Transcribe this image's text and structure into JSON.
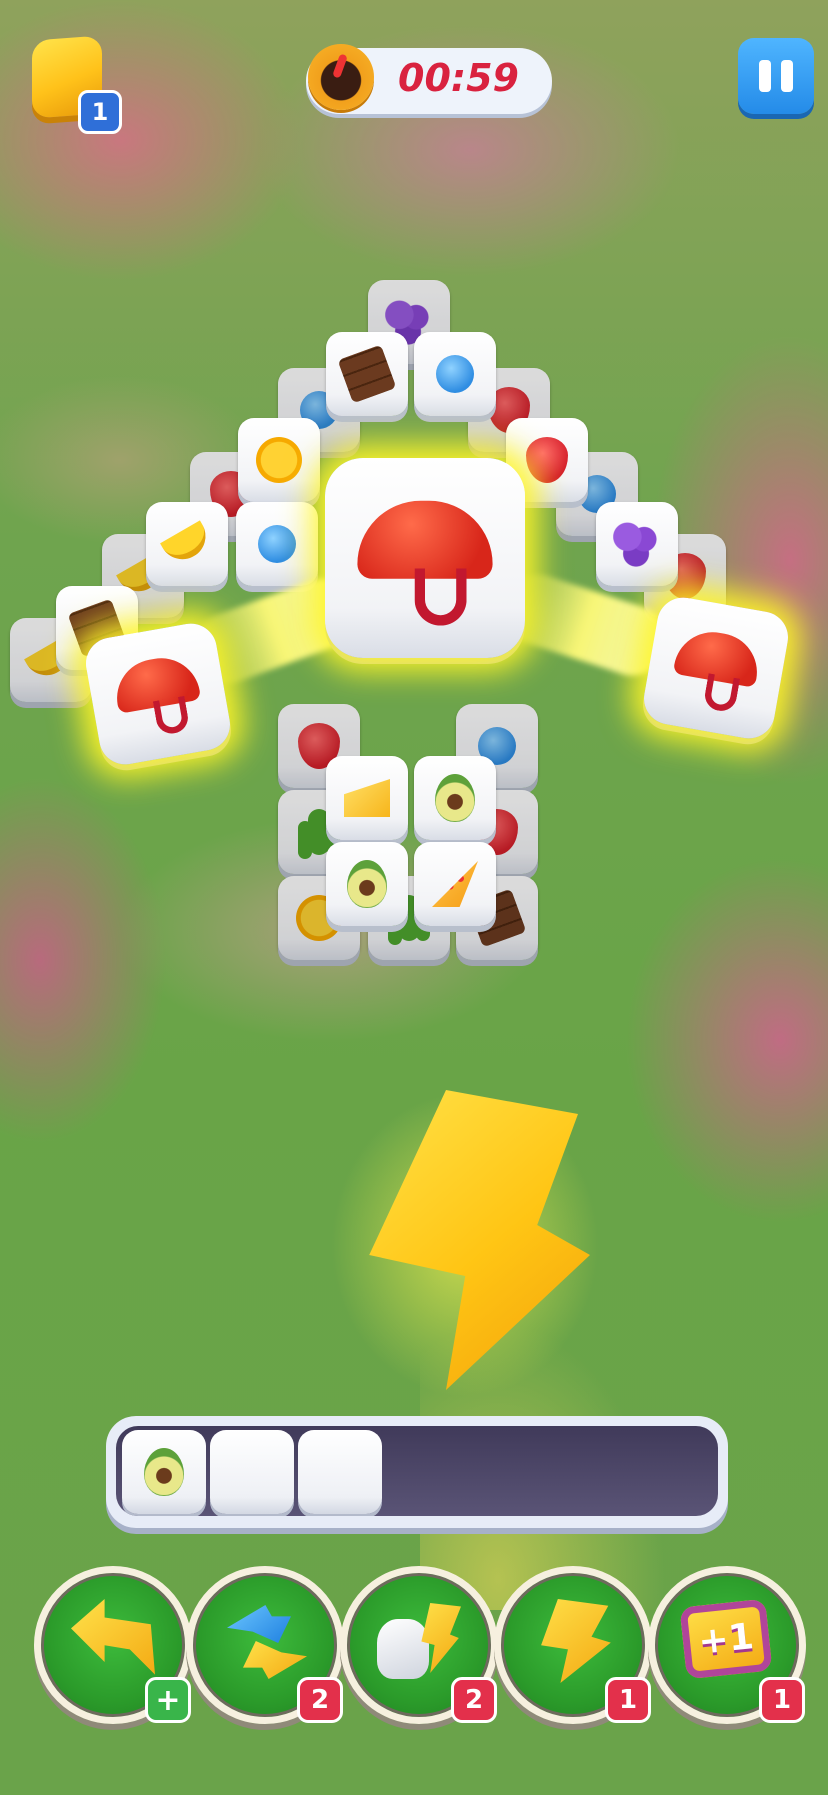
{
  "hud": {
    "lives_count": "1",
    "timer": "00:59",
    "pause_icon": "pause-icon"
  },
  "board": {
    "tiles": [
      {
        "symbol": "grape"
      },
      {
        "symbol": "chocolate"
      },
      {
        "symbol": "candy"
      },
      {
        "symbol": "sun"
      },
      {
        "symbol": "strawberry"
      },
      {
        "symbol": "banana"
      },
      {
        "symbol": "candy"
      },
      {
        "symbol": "grape"
      },
      {
        "symbol": "banana"
      },
      {
        "symbol": "chocolate"
      },
      {
        "symbol": "strawberry"
      },
      {
        "symbol": "cactus"
      },
      {
        "symbol": "grape"
      },
      {
        "symbol": "cheese"
      },
      {
        "symbol": "avocado"
      },
      {
        "symbol": "avocado"
      },
      {
        "symbol": "pizza"
      },
      {
        "symbol": "candy"
      }
    ],
    "matched_tiles": [
      {
        "symbol": "umbrella"
      },
      {
        "symbol": "umbrella"
      },
      {
        "symbol": "umbrella"
      }
    ]
  },
  "effect": {
    "icon": "lightning-bolt-icon"
  },
  "tray": {
    "capacity": 7,
    "slots": [
      {
        "symbol": "avocado"
      },
      {
        "symbol": "empty"
      },
      {
        "symbol": "empty"
      }
    ]
  },
  "boosters": [
    {
      "name": "undo",
      "icon": "undo-arrow-icon",
      "count": "+"
    },
    {
      "name": "shuffle",
      "icon": "shuffle-icon",
      "count": "2"
    },
    {
      "name": "magic",
      "icon": "magic-glove-icon",
      "count": "2"
    },
    {
      "name": "lightning",
      "icon": "lightning-icon",
      "count": "1"
    },
    {
      "name": "extra-slot",
      "icon": "plus-one-icon",
      "label": "+1",
      "count": "1"
    }
  ],
  "colors": {
    "timer_text": "#d9223f",
    "badge_red": "#e3304b",
    "badge_green": "#39b54a",
    "highlight_glow": "#fff528"
  }
}
